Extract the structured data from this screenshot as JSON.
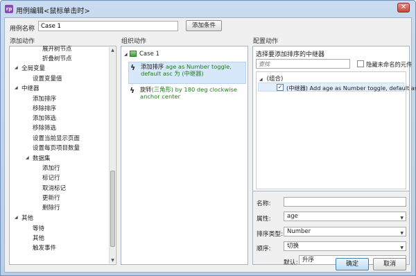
{
  "window": {
    "title": "用例编辑<鼠标单击时>",
    "app_icon": "rp"
  },
  "case": {
    "label": "用例名称",
    "value": "Case 1",
    "add_condition_label": "添加条件"
  },
  "sections": {
    "add_action": "添加动作",
    "organize_action": "组织动作",
    "configure_action": "配置动作"
  },
  "left_tree": [
    {
      "label": "展开树节点",
      "level": 3
    },
    {
      "label": "折叠树节点",
      "level": 3
    },
    {
      "label": "全局变量",
      "level": 1,
      "expander": "collapse"
    },
    {
      "label": "设置变量值",
      "level": 2
    },
    {
      "label": "中继器",
      "level": 1,
      "expander": "collapse"
    },
    {
      "label": "添加排序",
      "level": 2
    },
    {
      "label": "移除排序",
      "level": 2
    },
    {
      "label": "添加筛选",
      "level": 2
    },
    {
      "label": "移除筛选",
      "level": 2
    },
    {
      "label": "设置当前显示页面",
      "level": 2
    },
    {
      "label": "设置每页项目数量",
      "level": 2
    },
    {
      "label": "数据集",
      "level": 2,
      "expander": "collapse"
    },
    {
      "label": "添加行",
      "level": 3
    },
    {
      "label": "标记行",
      "level": 3
    },
    {
      "label": "取消标记",
      "level": 3
    },
    {
      "label": "更新行",
      "level": 3
    },
    {
      "label": "删除行",
      "level": 3
    },
    {
      "label": "其他",
      "level": 1,
      "expander": "collapse"
    },
    {
      "label": "等待",
      "level": 2
    },
    {
      "label": "其他",
      "level": 2
    },
    {
      "label": "触发事件",
      "level": 2
    }
  ],
  "middle": {
    "case_name": "Case 1",
    "actions": [
      {
        "name": "添加排序",
        "detail": "age as Number toggle, default asc 为 (中继器)"
      },
      {
        "name": "旋转",
        "detail": "(三角形) by 180 deg clockwise anchor center"
      }
    ]
  },
  "right": {
    "select_label": "选择要添加排序的中继器",
    "search_placeholder": "查找",
    "hide_unnamed_label": "隐藏未命名的元件",
    "group_label": "(组合)",
    "relay_item": "(中继器) Add age as Number toggle, default asc",
    "form": {
      "name_label": "名称:",
      "name_value": "",
      "attribute_label": "属性:",
      "attribute_value": "age",
      "sort_type_label": "排序类型:",
      "sort_type_value": "Number",
      "order_label": "顺序:",
      "order_value": "切换",
      "default_label": "默认:",
      "default_value": "升序"
    }
  },
  "buttons": {
    "ok": "确定",
    "cancel": "取消"
  }
}
